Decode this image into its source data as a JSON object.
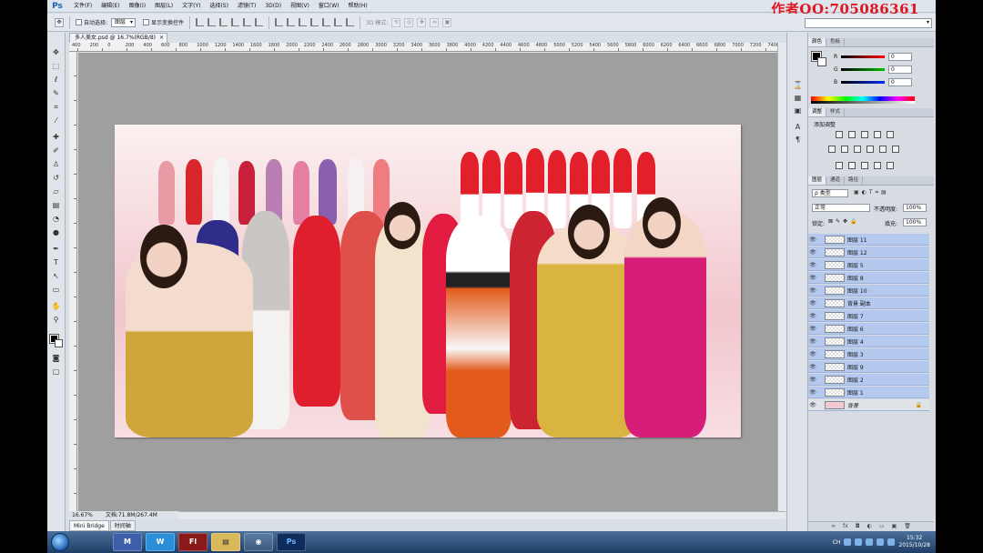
{
  "app": {
    "logo": "Ps",
    "author_watermark": "作者QQ:705086361"
  },
  "menu": [
    "文件(F)",
    "编辑(E)",
    "图像(I)",
    "图层(L)",
    "文字(Y)",
    "选择(S)",
    "滤镜(T)",
    "3D(D)",
    "视图(V)",
    "窗口(W)",
    "帮助(H)"
  ],
  "options": {
    "auto_select_label": "自动选择:",
    "auto_select_value": "图层",
    "show_transform_label": "显示变换控件",
    "mode_3d_label": "3D 模式:"
  },
  "document": {
    "tab_title": "多人美女.psd @ 16.7%(RGB/8)",
    "zoom": "16.67%",
    "doc_size": "文档:71.8M/267.4M",
    "ruler_labels": [
      "400",
      "200",
      "0",
      "200",
      "400",
      "600",
      "800",
      "1000",
      "1200",
      "1400",
      "1600",
      "1800",
      "2000",
      "2200",
      "2400",
      "2600",
      "2800",
      "3000",
      "3200",
      "3400",
      "3600",
      "3800",
      "4000",
      "4200",
      "4400",
      "4600",
      "4800",
      "5000",
      "5200",
      "5400",
      "5600",
      "5800",
      "6000",
      "6200",
      "6400",
      "6600",
      "6800",
      "7000",
      "7200",
      "7400"
    ]
  },
  "bottom_tabs": [
    "Mini Bridge",
    "时间轴"
  ],
  "color_panel": {
    "tabs": [
      "颜色",
      "色板"
    ],
    "channels": [
      {
        "name": "R",
        "value": "0",
        "color": "#d01010"
      },
      {
        "name": "G",
        "value": "0",
        "color": "#10a020"
      },
      {
        "name": "B",
        "value": "0",
        "color": "#1030d0"
      }
    ]
  },
  "adjust_panel": {
    "tabs": [
      "调整",
      "样式"
    ],
    "title": "添加调整"
  },
  "layers_panel": {
    "tabs": [
      "图层",
      "通道",
      "路径"
    ],
    "filter_value": "ρ 类型",
    "blend_mode": "正常",
    "opacity_label": "不透明度:",
    "opacity_value": "100%",
    "lock_label": "锁定:",
    "fill_label": "填充:",
    "fill_value": "100%",
    "layers": [
      {
        "name": "图层 11"
      },
      {
        "name": "图层 12"
      },
      {
        "name": "图层 5"
      },
      {
        "name": "图层 8"
      },
      {
        "name": "图层 10"
      },
      {
        "name": "背景 副本"
      },
      {
        "name": "图层 7"
      },
      {
        "name": "图层 6"
      },
      {
        "name": "图层 4"
      },
      {
        "name": "图层 3"
      },
      {
        "name": "图层 9"
      },
      {
        "name": "图层 2"
      },
      {
        "name": "图层 1"
      },
      {
        "name": "背景"
      }
    ],
    "footer_icons": [
      "∞",
      "fx",
      "◘",
      "◐",
      "▭",
      "▣",
      "🗑"
    ]
  },
  "taskbar": {
    "apps": [
      "M",
      "W",
      "Fl",
      "▤",
      "◉",
      "Ps"
    ],
    "tray_lang": "CH",
    "time": "15:32",
    "date": "2015/10/28"
  }
}
